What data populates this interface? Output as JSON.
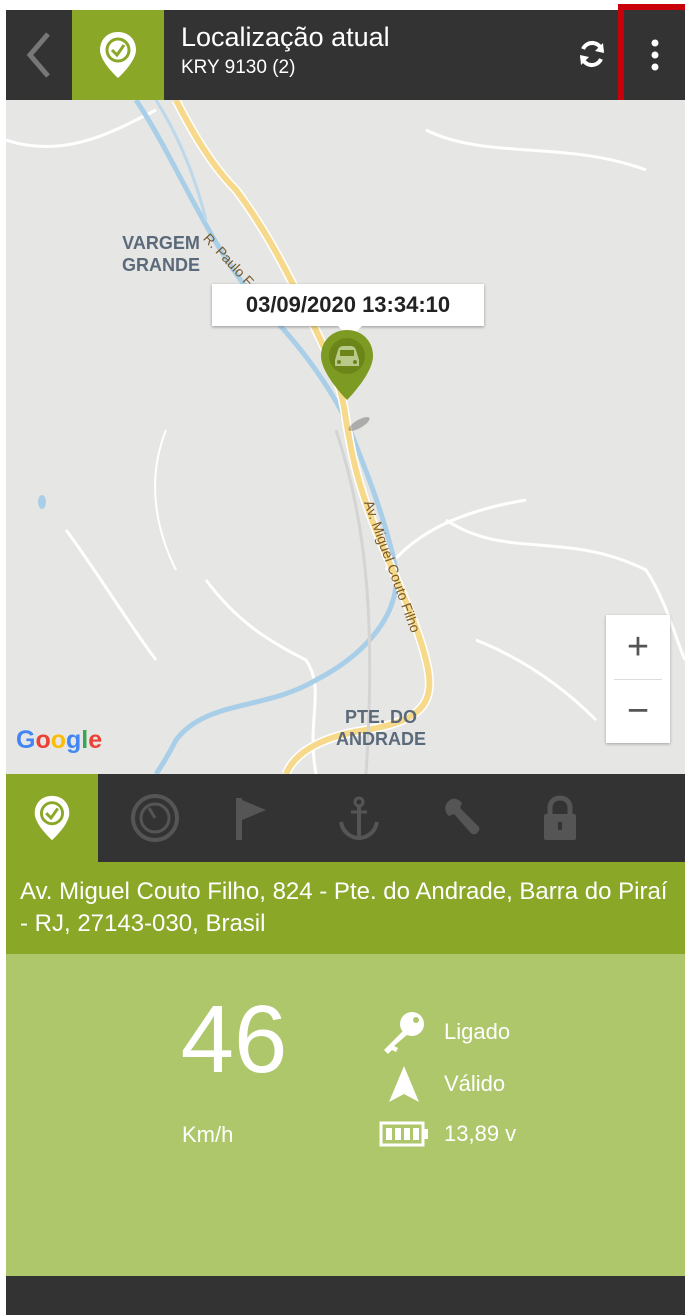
{
  "header": {
    "title": "Localização atual",
    "subtitle": "KRY 9130 (2)",
    "icons": [
      "back-icon",
      "location-check-icon",
      "refresh-icon",
      "more-vert-icon"
    ]
  },
  "map": {
    "timestamp": "03/09/2020 13:34:10",
    "labels": {
      "vargem_line1": "VARGEM",
      "vargem_line2": "GRANDE",
      "pte_line1": "PTE. DO",
      "pte_line2": "ANDRADE",
      "road1": "R. Paulo Ferna",
      "road2": "Av. Miguel Couto Filho"
    },
    "attribution": "Google",
    "zoom_in": "+",
    "zoom_out": "−"
  },
  "tabs": [
    {
      "name": "location-check-icon",
      "active": true
    },
    {
      "name": "speedometer-icon",
      "active": false
    },
    {
      "name": "flag-icon",
      "active": false
    },
    {
      "name": "anchor-icon",
      "active": false
    },
    {
      "name": "wrench-icon",
      "active": false
    },
    {
      "name": "lock-icon",
      "active": false
    }
  ],
  "address": "Av. Miguel Couto Filho, 824 - Pte. do Andrade, Barra do Piraí - RJ, 27143-030, Brasil",
  "status": {
    "speed": "46",
    "unit": "Km/h",
    "ignition": "Ligado",
    "gps": "Válido",
    "battery": "13,89 v"
  },
  "colors": {
    "brand_green": "#8aa727",
    "light_green": "#aec76b",
    "dark": "#333333",
    "highlight_red": "#c8000a"
  }
}
